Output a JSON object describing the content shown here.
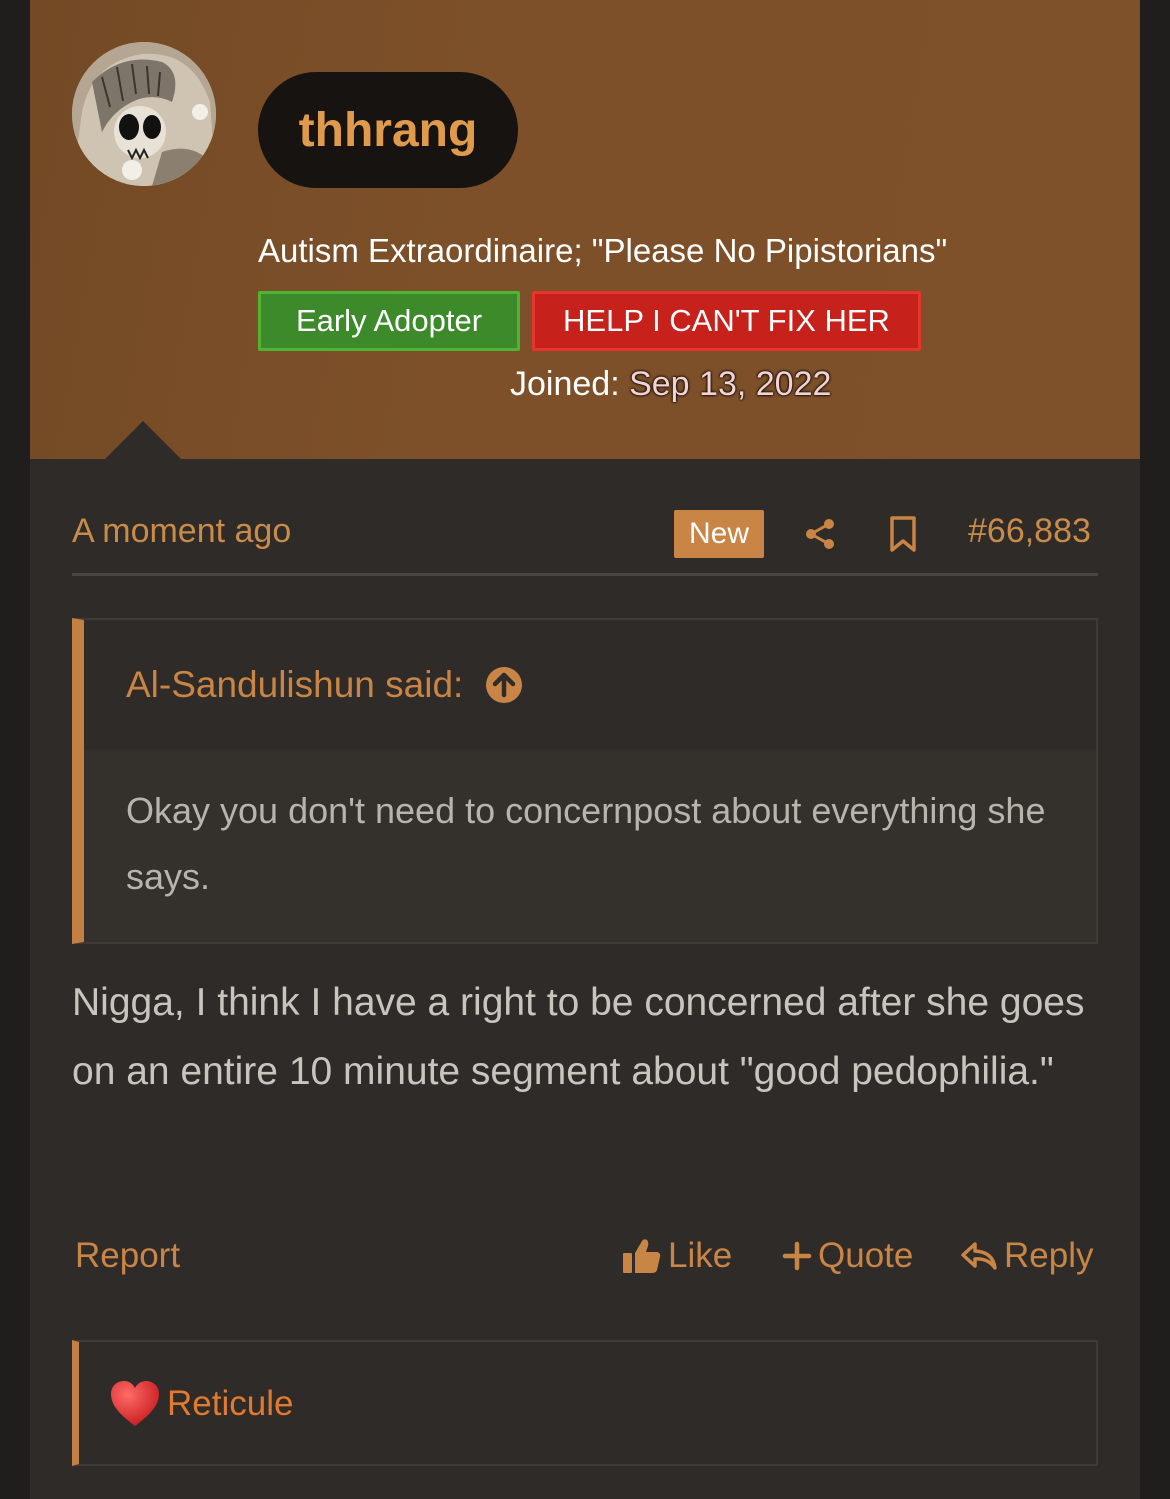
{
  "user": {
    "username": "thhrang",
    "title": "Autism Extraordinaire; \"Please No Pipistorians\"",
    "banners": [
      "Early Adopter",
      "HELP I CAN'T FIX HER"
    ],
    "joined_label": "Joined:",
    "joined_date": "Sep 13, 2022"
  },
  "post": {
    "time": "A moment ago",
    "new_badge": "New",
    "number": "#66,883",
    "quote_author": "Al-Sandulishun said:",
    "quote_text": "Okay you don't need to concernpost about everything she says.",
    "body": "Nigga, I think I have a right to be concerned after she goes on an entire 10 minute segment about \"good pedophilia.\""
  },
  "actions": {
    "report": "Report",
    "like": "Like",
    "quote": "Quote",
    "reply": "Reply"
  },
  "reactions": {
    "user": "Reticule"
  },
  "colors": {
    "accent": "#c98545",
    "header_bg": "#7d5029",
    "banner_green": "#3c8a29",
    "banner_red": "#c7211b"
  },
  "icons": [
    "share-icon",
    "bookmark-icon",
    "arrow-up-circle-icon",
    "thumbs-up-icon",
    "plus-icon",
    "reply-icon",
    "heart-icon"
  ]
}
